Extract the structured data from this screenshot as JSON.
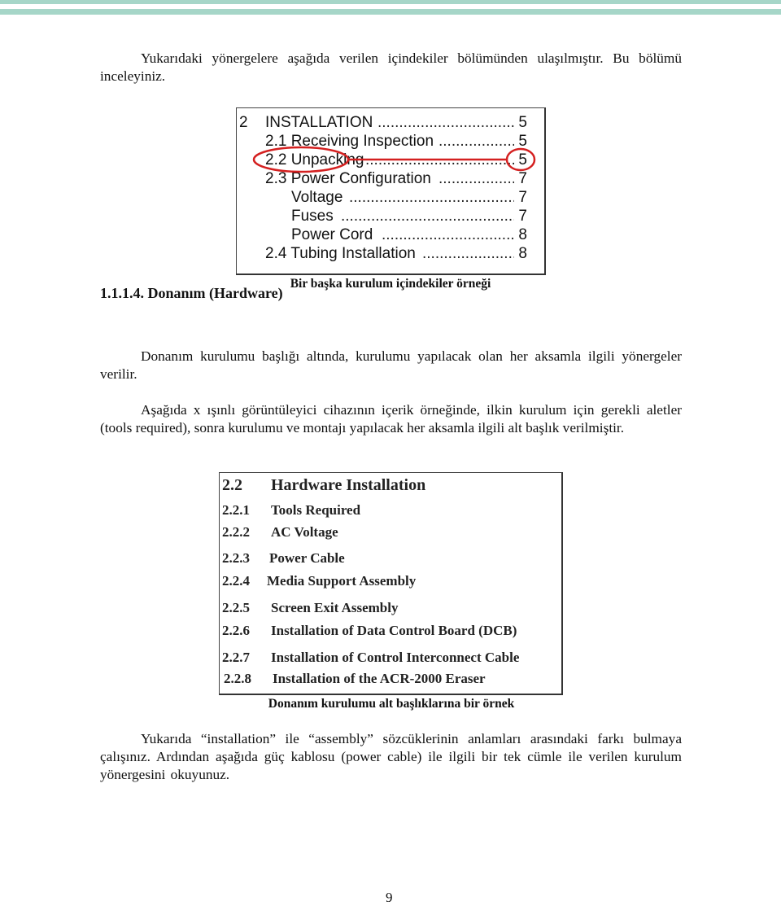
{
  "page": {
    "number": "9",
    "accent_bar_color": "#a6d6c8"
  },
  "intro": {
    "text": "Yukarıdaki yönergelere aşağıda verilen içindekiler bölümünden ulaşılmıştır. Bu bölümü inceleyiniz."
  },
  "figure1": {
    "caption": "Bir başka kurulum içindekiler örneği",
    "highlight_color": "#d42020",
    "highlighted_entry": "2.2 Unpacking",
    "entries": [
      {
        "num": "2",
        "label": "INSTALLATION",
        "page": "5"
      },
      {
        "num": "",
        "label": "2.1 Receiving Inspection",
        "page": "5"
      },
      {
        "num": "",
        "label": "2.2 Unpacking",
        "page": "5"
      },
      {
        "num": "",
        "label": "2.3 Power Configuration",
        "page": "7"
      },
      {
        "num": "",
        "label": "Voltage",
        "page": "7"
      },
      {
        "num": "",
        "label": "Fuses",
        "page": "7"
      },
      {
        "num": "",
        "label": "Power Cord",
        "page": "8"
      },
      {
        "num": "",
        "label": "2.4 Tubing Installation",
        "page": "8"
      }
    ]
  },
  "section": {
    "heading": "1.1.1.4. Donanım (Hardware)",
    "para1": "Donanım kurulumu başlığı altında, kurulumu yapılacak olan her aksamla ilgili yönergeler verilir.",
    "para2": "Aşağıda x ışınlı görüntüleyici cihazının içerik örneğinde, ilkin kurulum için gerekli aletler (tools required), sonra kurulumu ve montajı yapılacak her aksamla ilgili alt başlık verilmiştir."
  },
  "figure2": {
    "caption": "Donanım kurulumu alt başlıklarına bir örnek",
    "entries": [
      {
        "num": "2.2",
        "label": "Hardware Installation"
      },
      {
        "num": "2.2.1",
        "label": "Tools Required"
      },
      {
        "num": "2.2.2",
        "label": "AC Voltage"
      },
      {
        "num": "2.2.3",
        "label": "Power Cable"
      },
      {
        "num": "2.2.4",
        "label": "Media Support Assembly"
      },
      {
        "num": "2.2.5",
        "label": "Screen Exit Assembly"
      },
      {
        "num": "2.2.6",
        "label": "Installation of Data Control Board (DCB)"
      },
      {
        "num": "2.2.7",
        "label": "Installation of Control Interconnect Cable"
      },
      {
        "num": "2.2.8",
        "label": "Installation of the ACR-2000 Eraser"
      }
    ]
  },
  "closing": {
    "text": "Yukarıda “installation” ile “assembly” sözcüklerinin anlamları arasındaki farkı bulmaya çalışınız. Ardından aşağıda güç kablosu (power cable) ile ilgili bir tek cümle ile verilen kurulum yönergesini okuyunuz."
  }
}
